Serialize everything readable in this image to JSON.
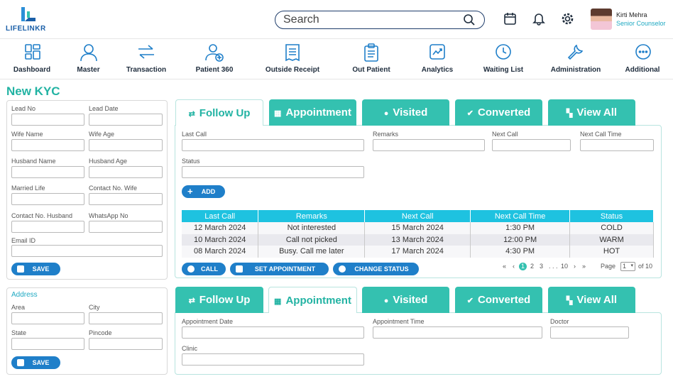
{
  "app": {
    "logo_text": "LIFELINKR"
  },
  "search": {
    "placeholder": "Search"
  },
  "user": {
    "name": "Kirti Mehra",
    "role": "Senior Counselor"
  },
  "nav": [
    {
      "label": "Dashboard",
      "icon": "dashboard-icon"
    },
    {
      "label": "Master",
      "icon": "user-icon"
    },
    {
      "label": "Transaction",
      "icon": "transfer-icon"
    },
    {
      "label": "Patient 360",
      "icon": "patient-icon"
    },
    {
      "label": "Outside Receipt",
      "icon": "receipt-icon"
    },
    {
      "label": "Out Patient",
      "icon": "clipboard-icon"
    },
    {
      "label": "Analytics",
      "icon": "analytics-icon"
    },
    {
      "label": "Waiting List",
      "icon": "clock-icon"
    },
    {
      "label": "Administration",
      "icon": "wrench-icon"
    },
    {
      "label": "Additional",
      "icon": "more-icon"
    }
  ],
  "page_title": "New KYC",
  "kyc_form": {
    "lead_no": "Lead No",
    "lead_date": "Lead Date",
    "wife_name": "Wife Name",
    "wife_age": "Wife Age",
    "husband_name": "Husband Name",
    "husband_age": "Husband Age",
    "married_life": "Married Life",
    "contact_wife": "Contact No. Wife",
    "contact_husband": "Contact No. Husband",
    "whatsapp": "WhatsApp No",
    "email": "Email ID",
    "save": "SAVE"
  },
  "address_form": {
    "title": "Address",
    "area": "Area",
    "city": "City",
    "state": "State",
    "pincode": "Pincode",
    "save": "SAVE"
  },
  "tabs": {
    "follow_up": "Follow Up",
    "appointment": "Appointment",
    "visited": "Visited",
    "converted": "Converted",
    "view_all": "View All"
  },
  "followup_form": {
    "last_call": "Last Call",
    "remarks": "Remarks",
    "next_call": "Next Call",
    "next_call_time": "Next Call Time",
    "status": "Status",
    "add": "ADD"
  },
  "followup_table": {
    "headers": [
      "Last Call",
      "Remarks",
      "Next Call",
      "Next Call Time",
      "Status"
    ],
    "rows": [
      [
        "12 March 2024",
        "Not interested",
        "15 March 2024",
        "1:30 PM",
        "COLD"
      ],
      [
        "10 March 2024",
        "Call not picked",
        "13 March 2024",
        "12:00 PM",
        "WARM"
      ],
      [
        "08 March 2024",
        "Busy. Call me later",
        "17 March 2024",
        "4:30 PM",
        "HOT"
      ]
    ]
  },
  "actions": {
    "call": "CALL",
    "set_appointment": "SET APPOINTMENT",
    "change_status": "CHANGE STATUS"
  },
  "pager": {
    "first": "«",
    "prev": "‹",
    "p1": "1",
    "p2": "2",
    "p3": "3",
    "dots": ". . .",
    "last_page": "10",
    "next": "›",
    "last": "»",
    "page_label": "Page",
    "page_value": "1",
    "of": "of 10"
  },
  "appointment_form": {
    "date": "Appointment Date",
    "time": "Appointment Time",
    "doctor": "Doctor",
    "clinic": "Clinic"
  },
  "colors": {
    "teal": "#34c1b0",
    "blue": "#1f7fc9",
    "table_header": "#1ec2e0"
  }
}
